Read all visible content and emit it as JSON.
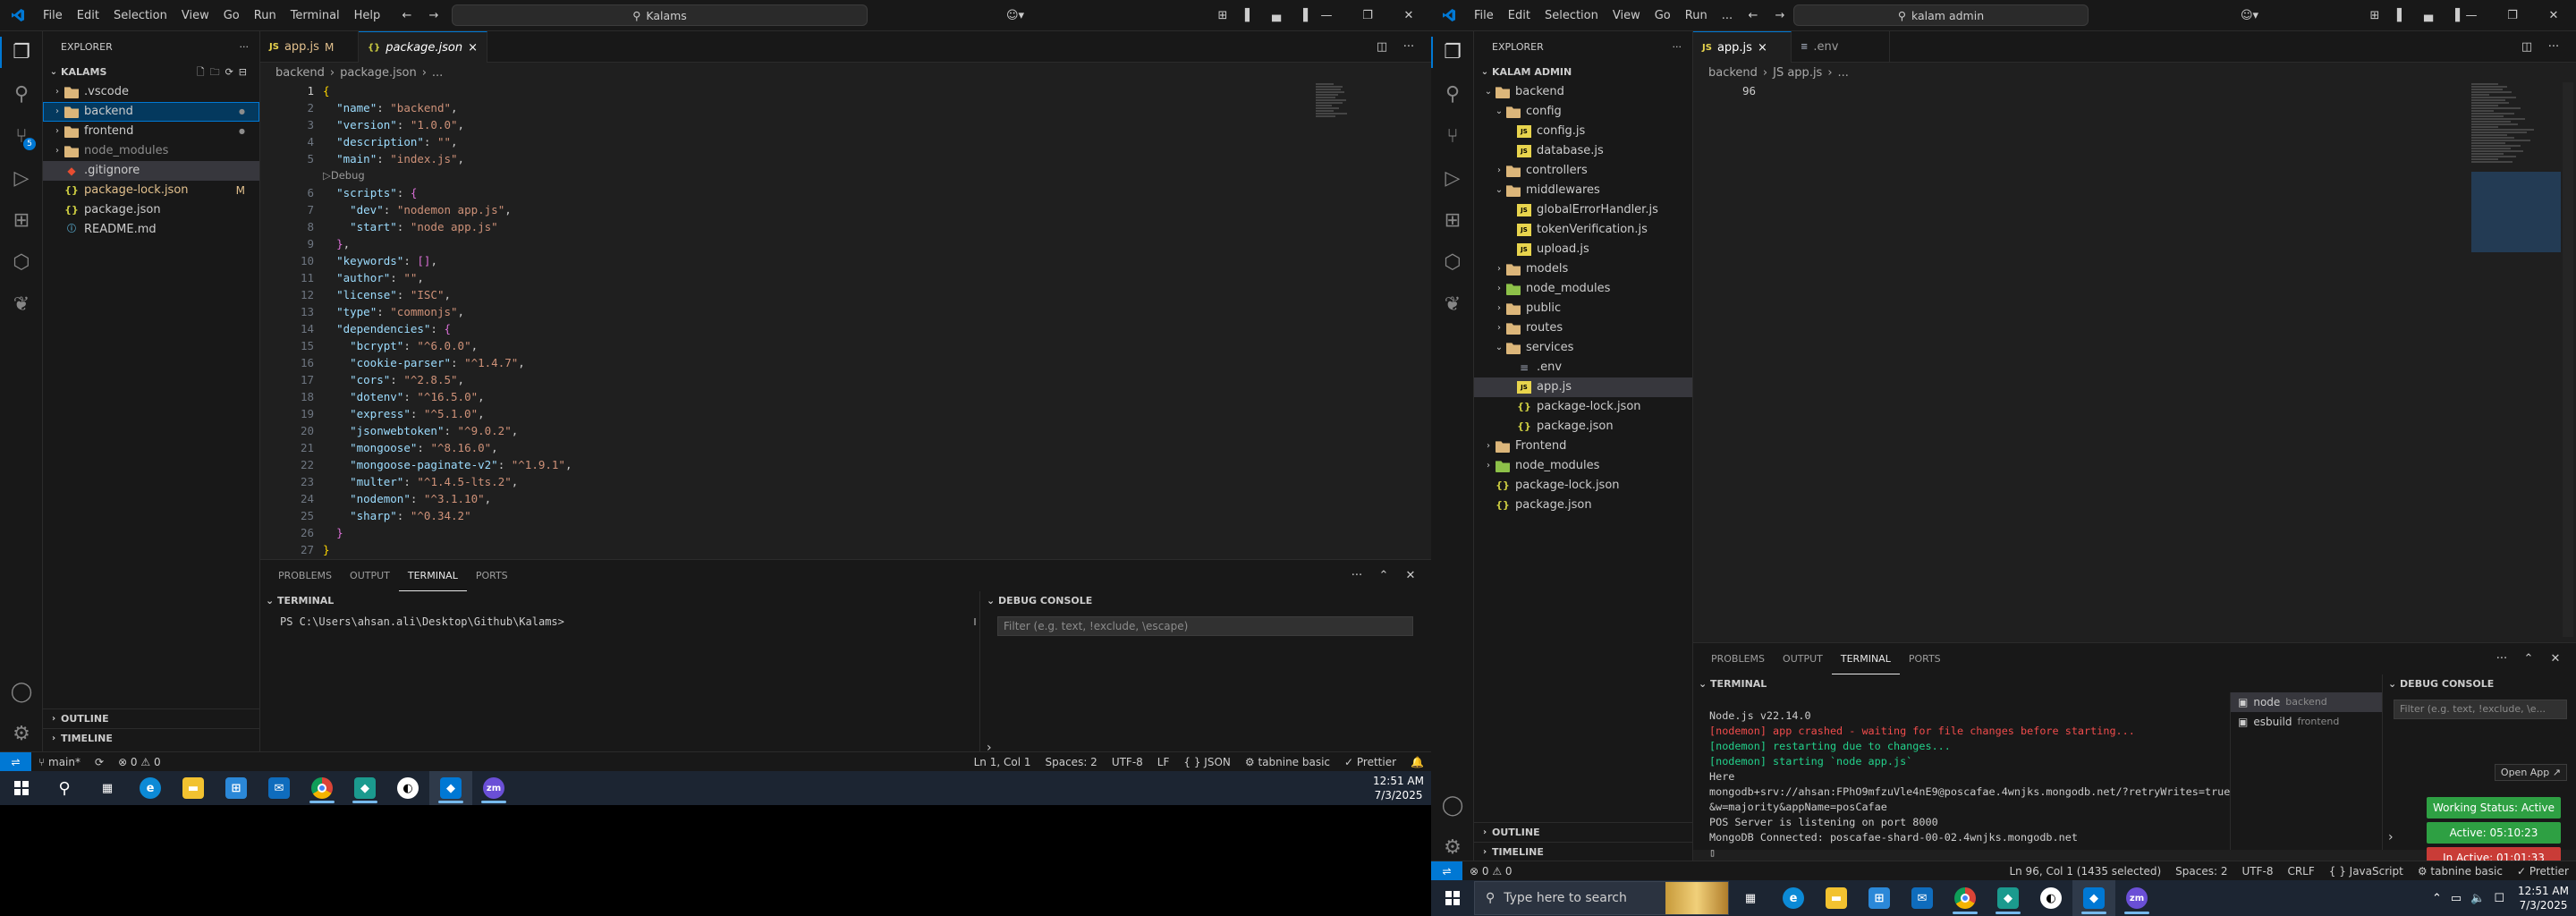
{
  "left": {
    "menu": [
      "File",
      "Edit",
      "Selection",
      "View",
      "Go",
      "Run",
      "Terminal",
      "Help"
    ],
    "search_label": "Kalams",
    "explorer_title": "EXPLORER",
    "workspace": "KALAMS",
    "tree": [
      {
        "label": ".vscode",
        "type": "folder",
        "level": 0,
        "open": false
      },
      {
        "label": "backend",
        "type": "folder",
        "level": 0,
        "open": false,
        "deco": "●",
        "focus": true
      },
      {
        "label": "frontend",
        "type": "folder",
        "level": 0,
        "open": false,
        "deco": "●"
      },
      {
        "label": "node_modules",
        "type": "folder",
        "level": 0,
        "open": false,
        "dim": true
      },
      {
        "label": ".gitignore",
        "type": "git",
        "level": 0,
        "sel": true
      },
      {
        "label": "package-lock.json",
        "type": "json",
        "level": 0,
        "deco": "M",
        "color": "#e2c08d"
      },
      {
        "label": "package.json",
        "type": "json",
        "level": 0
      },
      {
        "label": "README.md",
        "type": "md",
        "level": 0
      }
    ],
    "outline": "OUTLINE",
    "timeline": "TIMELINE",
    "tabs": [
      {
        "label": "app.js",
        "badge": "M",
        "icon": "JS"
      },
      {
        "label": "package.json",
        "close": "×",
        "icon": "{}",
        "active": true
      }
    ],
    "breadcrumb": [
      "backend",
      "package.json",
      "..."
    ],
    "code": [
      {
        "n": "1",
        "parts": [
          [
            "b",
            "{"
          ]
        ]
      },
      {
        "n": "2",
        "parts": [
          [
            "p",
            "  "
          ],
          [
            "k",
            "\"name\""
          ],
          [
            "p",
            ": "
          ],
          [
            "s",
            "\"backend\""
          ],
          [
            "p",
            ","
          ]
        ]
      },
      {
        "n": "3",
        "parts": [
          [
            "p",
            "  "
          ],
          [
            "k",
            "\"version\""
          ],
          [
            "p",
            ": "
          ],
          [
            "s",
            "\"1.0.0\""
          ],
          [
            "p",
            ","
          ]
        ]
      },
      {
        "n": "4",
        "parts": [
          [
            "p",
            "  "
          ],
          [
            "k",
            "\"description\""
          ],
          [
            "p",
            ": "
          ],
          [
            "s",
            "\"\""
          ],
          [
            "p",
            ","
          ]
        ]
      },
      {
        "n": "5",
        "parts": [
          [
            "p",
            "  "
          ],
          [
            "k",
            "\"main\""
          ],
          [
            "p",
            ": "
          ],
          [
            "s",
            "\"index.js\""
          ],
          [
            "p",
            ","
          ]
        ]
      },
      {
        "n": "",
        "lens": "▷Debug"
      },
      {
        "n": "6",
        "parts": [
          [
            "p",
            "  "
          ],
          [
            "k",
            "\"scripts\""
          ],
          [
            "p",
            ": "
          ],
          [
            "b2",
            "{"
          ]
        ]
      },
      {
        "n": "7",
        "parts": [
          [
            "p",
            "    "
          ],
          [
            "k",
            "\"dev\""
          ],
          [
            "p",
            ": "
          ],
          [
            "s",
            "\"nodemon app.js\""
          ],
          [
            "p",
            ","
          ]
        ]
      },
      {
        "n": "8",
        "parts": [
          [
            "p",
            "    "
          ],
          [
            "k",
            "\"start\""
          ],
          [
            "p",
            ": "
          ],
          [
            "s",
            "\"node app.js\""
          ]
        ]
      },
      {
        "n": "9",
        "parts": [
          [
            "p",
            "  "
          ],
          [
            "b2",
            "}"
          ],
          [
            "p",
            ","
          ]
        ]
      },
      {
        "n": "10",
        "parts": [
          [
            "p",
            "  "
          ],
          [
            "k",
            "\"keywords\""
          ],
          [
            "p",
            ": "
          ],
          [
            "b2",
            "[]"
          ],
          [
            "p",
            ","
          ]
        ]
      },
      {
        "n": "11",
        "parts": [
          [
            "p",
            "  "
          ],
          [
            "k",
            "\"author\""
          ],
          [
            "p",
            ": "
          ],
          [
            "s",
            "\"\""
          ],
          [
            "p",
            ","
          ]
        ]
      },
      {
        "n": "12",
        "parts": [
          [
            "p",
            "  "
          ],
          [
            "k",
            "\"license\""
          ],
          [
            "p",
            ": "
          ],
          [
            "s",
            "\"ISC\""
          ],
          [
            "p",
            ","
          ]
        ]
      },
      {
        "n": "13",
        "parts": [
          [
            "p",
            "  "
          ],
          [
            "k",
            "\"type\""
          ],
          [
            "p",
            ": "
          ],
          [
            "s",
            "\"commonjs\""
          ],
          [
            "p",
            ","
          ]
        ]
      },
      {
        "n": "14",
        "parts": [
          [
            "p",
            "  "
          ],
          [
            "k",
            "\"dependencies\""
          ],
          [
            "p",
            ": "
          ],
          [
            "b2",
            "{"
          ]
        ]
      },
      {
        "n": "15",
        "parts": [
          [
            "p",
            "    "
          ],
          [
            "k",
            "\"bcrypt\""
          ],
          [
            "p",
            ": "
          ],
          [
            "s",
            "\"^6.0.0\""
          ],
          [
            "p",
            ","
          ]
        ]
      },
      {
        "n": "16",
        "parts": [
          [
            "p",
            "    "
          ],
          [
            "k",
            "\"cookie-parser\""
          ],
          [
            "p",
            ": "
          ],
          [
            "s",
            "\"^1.4.7\""
          ],
          [
            "p",
            ","
          ]
        ]
      },
      {
        "n": "17",
        "parts": [
          [
            "p",
            "    "
          ],
          [
            "k",
            "\"cors\""
          ],
          [
            "p",
            ": "
          ],
          [
            "s",
            "\"^2.8.5\""
          ],
          [
            "p",
            ","
          ]
        ]
      },
      {
        "n": "18",
        "parts": [
          [
            "p",
            "    "
          ],
          [
            "k",
            "\"dotenv\""
          ],
          [
            "p",
            ": "
          ],
          [
            "s",
            "\"^16.5.0\""
          ],
          [
            "p",
            ","
          ]
        ]
      },
      {
        "n": "19",
        "parts": [
          [
            "p",
            "    "
          ],
          [
            "k",
            "\"express\""
          ],
          [
            "p",
            ": "
          ],
          [
            "s",
            "\"^5.1.0\""
          ],
          [
            "p",
            ","
          ]
        ]
      },
      {
        "n": "20",
        "parts": [
          [
            "p",
            "    "
          ],
          [
            "k",
            "\"jsonwebtoken\""
          ],
          [
            "p",
            ": "
          ],
          [
            "s",
            "\"^9.0.2\""
          ],
          [
            "p",
            ","
          ]
        ]
      },
      {
        "n": "21",
        "parts": [
          [
            "p",
            "    "
          ],
          [
            "k",
            "\"mongoose\""
          ],
          [
            "p",
            ": "
          ],
          [
            "s",
            "\"^8.16.0\""
          ],
          [
            "p",
            ","
          ]
        ]
      },
      {
        "n": "22",
        "parts": [
          [
            "p",
            "    "
          ],
          [
            "k",
            "\"mongoose-paginate-v2\""
          ],
          [
            "p",
            ": "
          ],
          [
            "s",
            "\"^1.9.1\""
          ],
          [
            "p",
            ","
          ]
        ]
      },
      {
        "n": "23",
        "parts": [
          [
            "p",
            "    "
          ],
          [
            "k",
            "\"multer\""
          ],
          [
            "p",
            ": "
          ],
          [
            "s",
            "\"^1.4.5-lts.2\""
          ],
          [
            "p",
            ","
          ]
        ]
      },
      {
        "n": "24",
        "parts": [
          [
            "p",
            "    "
          ],
          [
            "k",
            "\"nodemon\""
          ],
          [
            "p",
            ": "
          ],
          [
            "s",
            "\"^3.1.10\""
          ],
          [
            "p",
            ","
          ]
        ]
      },
      {
        "n": "25",
        "parts": [
          [
            "p",
            "    "
          ],
          [
            "k",
            "\"sharp\""
          ],
          [
            "p",
            ": "
          ],
          [
            "s",
            "\"^0.34.2\""
          ]
        ]
      },
      {
        "n": "26",
        "parts": [
          [
            "p",
            "  "
          ],
          [
            "b2",
            "}"
          ]
        ]
      },
      {
        "n": "27",
        "parts": [
          [
            "b",
            "}"
          ]
        ]
      }
    ],
    "panel_tabs": [
      "PROBLEMS",
      "OUTPUT",
      "TERMINAL",
      "PORTS"
    ],
    "terminal_head": "TERMINAL",
    "terminal_prompt": "PS C:\\Users\\ahsan.ali\\Desktop\\Github\\Kalams>",
    "debug_head": "DEBUG CONSOLE",
    "debug_filter": "Filter (e.g. text, !exclude, \\escape)",
    "status": {
      "branch": "main*",
      "sync": "⟳",
      "problems": "⊗ 0 ⚠ 0",
      "cursor": "Ln 1, Col 1",
      "spaces": "Spaces: 2",
      "encoding": "UTF-8",
      "eol": "LF",
      "lang": "{ } JSON",
      "tabnine": "⚙ tabnine basic",
      "prettier": "✓ Prettier",
      "bell": "🔔"
    },
    "time": "12:51 AM",
    "date": "7/3/2025"
  },
  "right": {
    "menu": [
      "File",
      "Edit",
      "Selection",
      "View",
      "Go",
      "Run",
      "..."
    ],
    "search_label": "kalam admin",
    "explorer_title": "EXPLORER",
    "workspace": "KALAM ADMIN",
    "tree": [
      {
        "label": "backend",
        "type": "folder",
        "level": 0,
        "open": true
      },
      {
        "label": "config",
        "type": "folder",
        "level": 1,
        "open": true
      },
      {
        "label": "config.js",
        "type": "js",
        "level": 2
      },
      {
        "label": "database.js",
        "type": "js",
        "level": 2
      },
      {
        "label": "controllers",
        "type": "folder",
        "level": 1,
        "open": false
      },
      {
        "label": "middlewares",
        "type": "folder",
        "level": 1,
        "open": true
      },
      {
        "label": "globalErrorHandler.js",
        "type": "js",
        "level": 2
      },
      {
        "label": "tokenVerification.js",
        "type": "js",
        "level": 2
      },
      {
        "label": "upload.js",
        "type": "js",
        "level": 2
      },
      {
        "label": "models",
        "type": "folder",
        "level": 1,
        "open": false
      },
      {
        "label": "node_modules",
        "type": "folder",
        "level": 1,
        "open": false,
        "color": "#8dc149"
      },
      {
        "label": "public",
        "type": "folder",
        "level": 1,
        "open": false
      },
      {
        "label": "routes",
        "type": "folder",
        "level": 1,
        "open": false
      },
      {
        "label": "services",
        "type": "folder",
        "level": 1,
        "open": true
      },
      {
        "label": ".env",
        "type": "env",
        "level": 2
      },
      {
        "label": "app.js",
        "type": "js",
        "level": 2,
        "sel": true
      },
      {
        "label": "package-lock.json",
        "type": "json",
        "level": 2
      },
      {
        "label": "package.json",
        "type": "json",
        "level": 2
      },
      {
        "label": "Frontend",
        "type": "folder",
        "level": 0,
        "open": false
      },
      {
        "label": "node_modules",
        "type": "folder",
        "level": 0,
        "open": false,
        "color": "#8dc149"
      },
      {
        "label": "package-lock.json",
        "type": "json",
        "level": 0
      },
      {
        "label": "package.json",
        "type": "json",
        "level": 0
      }
    ],
    "outline": "OUTLINE",
    "timeline": "TIMELINE",
    "tabs": [
      {
        "label": "app.js",
        "close": "×",
        "icon": "JS",
        "active": true
      },
      {
        "label": ".env",
        "icon": "≡"
      }
    ],
    "breadcrumb": [
      "backend",
      "JS app.js",
      "..."
    ],
    "line_no": "96",
    "panel_tabs": [
      "PROBLEMS",
      "OUTPUT",
      "TERMINAL",
      "PORTS"
    ],
    "terminal_head": "TERMINAL",
    "terminal_lines": [
      {
        "t": "Node.js v22.14.0",
        "c": ""
      },
      {
        "t": "[nodemon] app crashed - waiting for file changes before starting...",
        "c": "red"
      },
      {
        "t": "[nodemon] restarting due to changes...",
        "c": "green"
      },
      {
        "t": "[nodemon] starting `node app.js`",
        "c": "green"
      },
      {
        "t": "Here",
        "c": ""
      },
      {
        "t": "mongodb+srv://ahsan:FPhO9mfzuVle4nE9@poscafae.4wnjks.mongodb.net/?retryWrites=true",
        "c": ""
      },
      {
        "t": "&w=majority&appName=posCafae",
        "c": ""
      },
      {
        "t": "POS Server is listening on port 8000",
        "c": ""
      },
      {
        "t": "MongoDB Connected: poscafae-shard-00-02.4wnjks.mongodb.net",
        "c": ""
      },
      {
        "t": "▯",
        "c": ""
      }
    ],
    "terminals": [
      {
        "name": "node",
        "folder": "backend"
      },
      {
        "name": "esbuild",
        "folder": "frontend"
      }
    ],
    "debug_head": "DEBUG CONSOLE",
    "debug_filter": "Filter (e.g. text, !exclude, \\e...",
    "open_app": "Open App ↗",
    "pills": [
      {
        "label": "Working Status: Active",
        "color": "#2ea043"
      },
      {
        "label": "Active: 05:10:23",
        "color": "#2ea043"
      },
      {
        "label": "In Active: 01:01:33",
        "color": "#c93c37"
      }
    ],
    "status": {
      "problems": "⊗ 0 ⚠ 0",
      "cursor": "Ln 96, Col 1 (1435 selected)",
      "spaces": "Spaces: 2",
      "encoding": "UTF-8",
      "eol": "CRLF",
      "lang": "{ } JavaScript",
      "extra": "⚙ tabnine basic",
      "prettier": "✓ Prettier"
    },
    "taskbar_search": "Type here to search",
    "time": "12:51 AM",
    "date": "7/3/2025"
  }
}
